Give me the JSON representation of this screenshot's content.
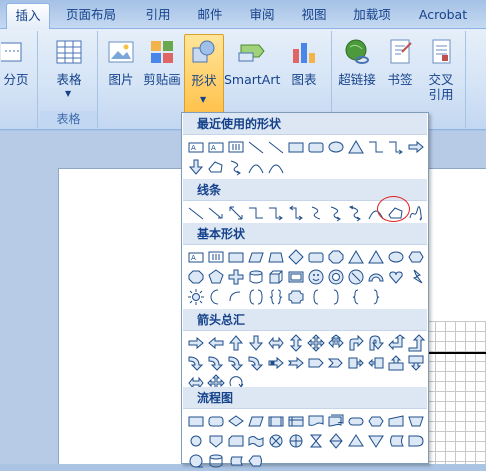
{
  "tabs": [
    {
      "id": "insert",
      "label": "插入",
      "active": true
    },
    {
      "id": "layout",
      "label": "页面布局"
    },
    {
      "id": "references",
      "label": "引用"
    },
    {
      "id": "mailings",
      "label": "邮件"
    },
    {
      "id": "review",
      "label": "审阅"
    },
    {
      "id": "view",
      "label": "视图"
    },
    {
      "id": "addins",
      "label": "加载项"
    },
    {
      "id": "acrobat",
      "label": "Acrobat"
    }
  ],
  "ribbon": {
    "pages_label": "分页",
    "table_label": "表格",
    "tables_group": "表格",
    "picture_label": "图片",
    "clipart_label": "剪贴画",
    "shapes_label": "形状",
    "smartart_label": "SmartArt",
    "chart_label": "图表",
    "hyperlink_label": "超链接",
    "bookmark_label": "书签",
    "crossref_label": "交叉引用"
  },
  "gallery": {
    "recent": "最近使用的形状",
    "lines": "线条",
    "basic": "基本形状",
    "arrows": "箭头总汇",
    "flowchart": "流程图"
  },
  "colors": {
    "accent": "#ffc24c",
    "ribbon": "#d5e4f6",
    "highlight_circle": "#e02020",
    "shape_stroke": "#1f4e8a"
  }
}
